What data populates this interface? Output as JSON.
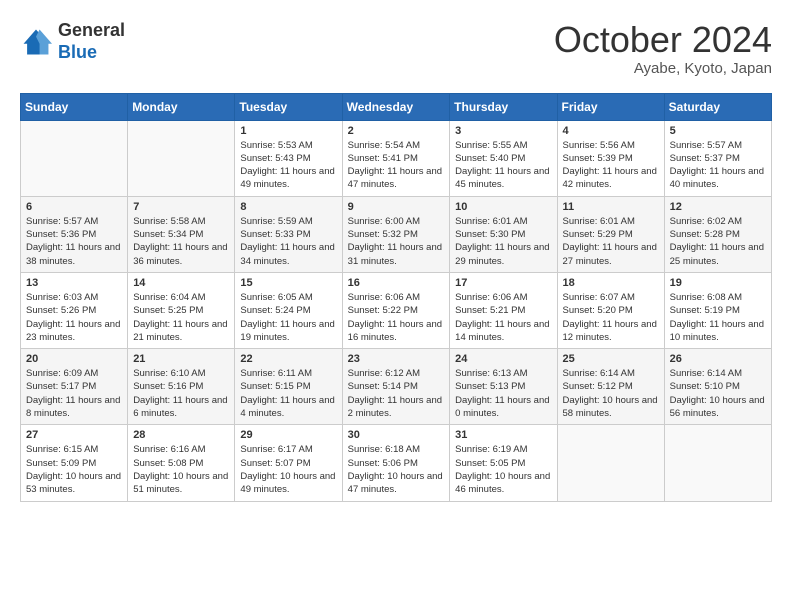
{
  "header": {
    "logo": {
      "general": "General",
      "blue": "Blue"
    },
    "title": "October 2024",
    "location": "Ayabe, Kyoto, Japan"
  },
  "weekdays": [
    "Sunday",
    "Monday",
    "Tuesday",
    "Wednesday",
    "Thursday",
    "Friday",
    "Saturday"
  ],
  "weeks": [
    [
      {
        "day": "",
        "sunrise": "",
        "sunset": "",
        "daylight": ""
      },
      {
        "day": "",
        "sunrise": "",
        "sunset": "",
        "daylight": ""
      },
      {
        "day": "1",
        "sunrise": "Sunrise: 5:53 AM",
        "sunset": "Sunset: 5:43 PM",
        "daylight": "Daylight: 11 hours and 49 minutes."
      },
      {
        "day": "2",
        "sunrise": "Sunrise: 5:54 AM",
        "sunset": "Sunset: 5:41 PM",
        "daylight": "Daylight: 11 hours and 47 minutes."
      },
      {
        "day": "3",
        "sunrise": "Sunrise: 5:55 AM",
        "sunset": "Sunset: 5:40 PM",
        "daylight": "Daylight: 11 hours and 45 minutes."
      },
      {
        "day": "4",
        "sunrise": "Sunrise: 5:56 AM",
        "sunset": "Sunset: 5:39 PM",
        "daylight": "Daylight: 11 hours and 42 minutes."
      },
      {
        "day": "5",
        "sunrise": "Sunrise: 5:57 AM",
        "sunset": "Sunset: 5:37 PM",
        "daylight": "Daylight: 11 hours and 40 minutes."
      }
    ],
    [
      {
        "day": "6",
        "sunrise": "Sunrise: 5:57 AM",
        "sunset": "Sunset: 5:36 PM",
        "daylight": "Daylight: 11 hours and 38 minutes."
      },
      {
        "day": "7",
        "sunrise": "Sunrise: 5:58 AM",
        "sunset": "Sunset: 5:34 PM",
        "daylight": "Daylight: 11 hours and 36 minutes."
      },
      {
        "day": "8",
        "sunrise": "Sunrise: 5:59 AM",
        "sunset": "Sunset: 5:33 PM",
        "daylight": "Daylight: 11 hours and 34 minutes."
      },
      {
        "day": "9",
        "sunrise": "Sunrise: 6:00 AM",
        "sunset": "Sunset: 5:32 PM",
        "daylight": "Daylight: 11 hours and 31 minutes."
      },
      {
        "day": "10",
        "sunrise": "Sunrise: 6:01 AM",
        "sunset": "Sunset: 5:30 PM",
        "daylight": "Daylight: 11 hours and 29 minutes."
      },
      {
        "day": "11",
        "sunrise": "Sunrise: 6:01 AM",
        "sunset": "Sunset: 5:29 PM",
        "daylight": "Daylight: 11 hours and 27 minutes."
      },
      {
        "day": "12",
        "sunrise": "Sunrise: 6:02 AM",
        "sunset": "Sunset: 5:28 PM",
        "daylight": "Daylight: 11 hours and 25 minutes."
      }
    ],
    [
      {
        "day": "13",
        "sunrise": "Sunrise: 6:03 AM",
        "sunset": "Sunset: 5:26 PM",
        "daylight": "Daylight: 11 hours and 23 minutes."
      },
      {
        "day": "14",
        "sunrise": "Sunrise: 6:04 AM",
        "sunset": "Sunset: 5:25 PM",
        "daylight": "Daylight: 11 hours and 21 minutes."
      },
      {
        "day": "15",
        "sunrise": "Sunrise: 6:05 AM",
        "sunset": "Sunset: 5:24 PM",
        "daylight": "Daylight: 11 hours and 19 minutes."
      },
      {
        "day": "16",
        "sunrise": "Sunrise: 6:06 AM",
        "sunset": "Sunset: 5:22 PM",
        "daylight": "Daylight: 11 hours and 16 minutes."
      },
      {
        "day": "17",
        "sunrise": "Sunrise: 6:06 AM",
        "sunset": "Sunset: 5:21 PM",
        "daylight": "Daylight: 11 hours and 14 minutes."
      },
      {
        "day": "18",
        "sunrise": "Sunrise: 6:07 AM",
        "sunset": "Sunset: 5:20 PM",
        "daylight": "Daylight: 11 hours and 12 minutes."
      },
      {
        "day": "19",
        "sunrise": "Sunrise: 6:08 AM",
        "sunset": "Sunset: 5:19 PM",
        "daylight": "Daylight: 11 hours and 10 minutes."
      }
    ],
    [
      {
        "day": "20",
        "sunrise": "Sunrise: 6:09 AM",
        "sunset": "Sunset: 5:17 PM",
        "daylight": "Daylight: 11 hours and 8 minutes."
      },
      {
        "day": "21",
        "sunrise": "Sunrise: 6:10 AM",
        "sunset": "Sunset: 5:16 PM",
        "daylight": "Daylight: 11 hours and 6 minutes."
      },
      {
        "day": "22",
        "sunrise": "Sunrise: 6:11 AM",
        "sunset": "Sunset: 5:15 PM",
        "daylight": "Daylight: 11 hours and 4 minutes."
      },
      {
        "day": "23",
        "sunrise": "Sunrise: 6:12 AM",
        "sunset": "Sunset: 5:14 PM",
        "daylight": "Daylight: 11 hours and 2 minutes."
      },
      {
        "day": "24",
        "sunrise": "Sunrise: 6:13 AM",
        "sunset": "Sunset: 5:13 PM",
        "daylight": "Daylight: 11 hours and 0 minutes."
      },
      {
        "day": "25",
        "sunrise": "Sunrise: 6:14 AM",
        "sunset": "Sunset: 5:12 PM",
        "daylight": "Daylight: 10 hours and 58 minutes."
      },
      {
        "day": "26",
        "sunrise": "Sunrise: 6:14 AM",
        "sunset": "Sunset: 5:10 PM",
        "daylight": "Daylight: 10 hours and 56 minutes."
      }
    ],
    [
      {
        "day": "27",
        "sunrise": "Sunrise: 6:15 AM",
        "sunset": "Sunset: 5:09 PM",
        "daylight": "Daylight: 10 hours and 53 minutes."
      },
      {
        "day": "28",
        "sunrise": "Sunrise: 6:16 AM",
        "sunset": "Sunset: 5:08 PM",
        "daylight": "Daylight: 10 hours and 51 minutes."
      },
      {
        "day": "29",
        "sunrise": "Sunrise: 6:17 AM",
        "sunset": "Sunset: 5:07 PM",
        "daylight": "Daylight: 10 hours and 49 minutes."
      },
      {
        "day": "30",
        "sunrise": "Sunrise: 6:18 AM",
        "sunset": "Sunset: 5:06 PM",
        "daylight": "Daylight: 10 hours and 47 minutes."
      },
      {
        "day": "31",
        "sunrise": "Sunrise: 6:19 AM",
        "sunset": "Sunset: 5:05 PM",
        "daylight": "Daylight: 10 hours and 46 minutes."
      },
      {
        "day": "",
        "sunrise": "",
        "sunset": "",
        "daylight": ""
      },
      {
        "day": "",
        "sunrise": "",
        "sunset": "",
        "daylight": ""
      }
    ]
  ]
}
